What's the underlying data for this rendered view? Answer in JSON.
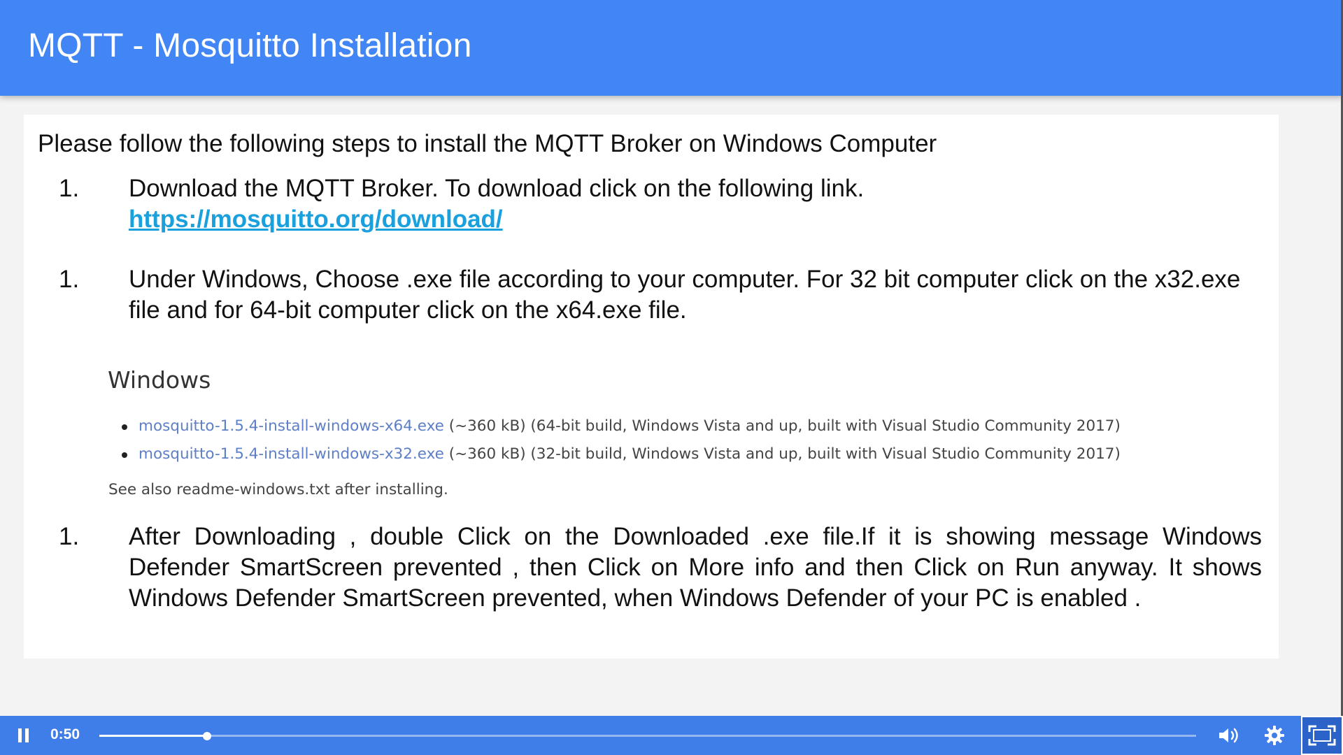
{
  "slide": {
    "title": "MQTT - Mosquitto Installation",
    "intro": "Please follow the following steps to install the MQTT Broker on Windows Computer",
    "steps": [
      {
        "number": "1.",
        "text": "Download the MQTT Broker. To download click on the following link.",
        "link": "https://mosquitto.org/download/"
      },
      {
        "number": "1.",
        "text": "Under Windows, Choose .exe file according to your computer. For 32 bit computer click on the x32.exe file and for 64-bit computer click on the x64.exe file."
      },
      {
        "number": "1.",
        "text": "After Downloading , double Click on the Downloaded .exe file.If it is showing message Windows Defender SmartScreen prevented , then Click on More info and    then Click on Run anyway. It shows Windows Defender SmartScreen prevented, when Windows Defender of your PC is enabled ."
      }
    ],
    "download_section": {
      "heading": "Windows",
      "items": [
        {
          "link": "mosquitto-1.5.4-install-windows-x64.exe",
          "desc": " (~360 kB) (64-bit build, Windows Vista and up, built with Visual Studio Community 2017)"
        },
        {
          "link": "mosquitto-1.5.4-install-windows-x32.exe",
          "desc": " (~360 kB) (32-bit build, Windows Vista and up, built with Visual Studio Community 2017)"
        }
      ],
      "note": "See also readme-windows.txt after installing."
    }
  },
  "player": {
    "time": "0:50",
    "progress_fraction": 0.098,
    "icons": {
      "pause": "pause-icon",
      "volume": "volume-icon",
      "settings": "gear-icon",
      "fullscreen": "fullscreen-icon"
    },
    "colors": {
      "header": "#4285f4",
      "control_bar": "#3f7de8",
      "link": "#1aa0dc"
    }
  }
}
